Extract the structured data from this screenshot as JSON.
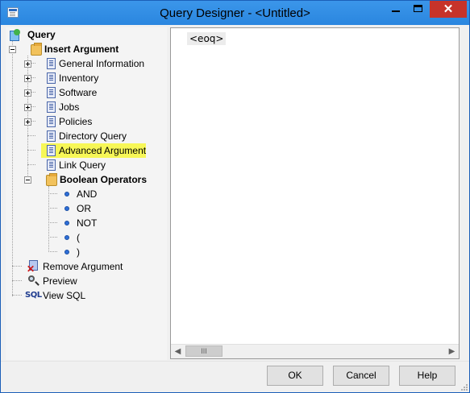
{
  "window": {
    "title": "Query Designer - <Untitled>",
    "close_glyph": "✕"
  },
  "tree": {
    "root": {
      "label": "Query",
      "icon": "query-icon"
    },
    "insert_argument": {
      "label": "Insert Argument",
      "icon": "folder-icon",
      "items": [
        {
          "label": "General Information",
          "icon": "document-icon",
          "expandable": true
        },
        {
          "label": "Inventory",
          "icon": "document-icon",
          "expandable": true
        },
        {
          "label": "Software",
          "icon": "document-icon",
          "expandable": true
        },
        {
          "label": "Jobs",
          "icon": "document-icon",
          "expandable": true
        },
        {
          "label": "Policies",
          "icon": "document-icon",
          "expandable": true
        },
        {
          "label": "Directory Query",
          "icon": "document-icon",
          "expandable": false
        },
        {
          "label": "Advanced Argument",
          "icon": "document-icon",
          "expandable": false,
          "highlighted": true
        },
        {
          "label": "Link Query",
          "icon": "document-icon",
          "expandable": false
        }
      ],
      "boolean_operators": {
        "label": "Boolean Operators",
        "icon": "folder-icon",
        "items": [
          "AND",
          "OR",
          "NOT",
          "(",
          ")"
        ]
      }
    },
    "remove_argument": {
      "label": "Remove Argument",
      "icon": "remove-icon"
    },
    "preview": {
      "label": "Preview",
      "icon": "magnifier-icon"
    },
    "view_sql": {
      "label": "View SQL",
      "icon": "sql-icon",
      "icon_text": "SQL"
    }
  },
  "editor": {
    "content": "<eoq>",
    "scroll_thumb": "III"
  },
  "buttons": {
    "ok": "OK",
    "cancel": "Cancel",
    "help": "Help"
  },
  "colors": {
    "titlebar": "#2b8ae2",
    "close_button": "#c7332a",
    "highlight": "#f7f757"
  }
}
